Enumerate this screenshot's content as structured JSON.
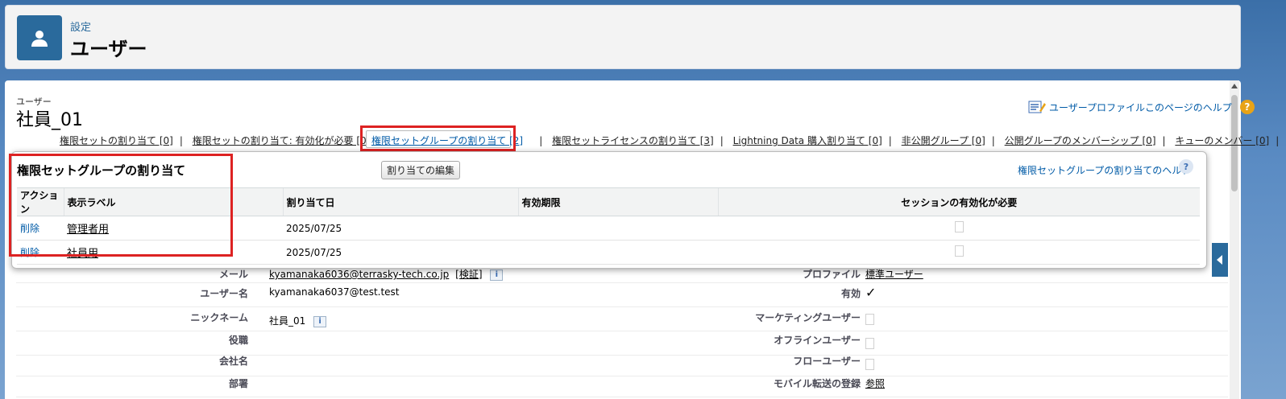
{
  "header": {
    "section": "設定",
    "title": "ユーザー"
  },
  "user": {
    "type_label": "ユーザー",
    "name": "社員_01"
  },
  "help": {
    "label": "ユーザープロファイルこのページのヘルプ",
    "q": "?"
  },
  "related_links": [
    "権限セットの割り当て [0]",
    "権限セットの割り当て: 有効化が必要 [0]",
    "権限セットグループの割り当て [2]",
    "権限セットライセンスの割り当て [3]",
    "Lightning Data 購入割り当て [0]",
    "非公開グループ [0]",
    "公開グループのメンバーシップ [0]",
    "キューのメンバー [0]"
  ],
  "overlay": {
    "title": "権限セットグループの割り当て",
    "edit_button": "割り当ての編集",
    "help_link": "権限セットグループの割り当てのヘルプ",
    "help_q": "?",
    "columns": [
      "アクション",
      "表示ラベル",
      "割り当て日",
      "有効期限",
      "セッションの有効化が必要"
    ],
    "rows": [
      {
        "action": "削除",
        "label": "管理者用",
        "date": "2025/07/25",
        "expiry": "",
        "session": false
      },
      {
        "action": "削除",
        "label": "社員用",
        "date": "2025/07/25",
        "expiry": "",
        "session": false
      }
    ]
  },
  "details": {
    "email_label": "メール",
    "email_value": "kyamanaka6036@terrasky-tech.co.jp",
    "verify": "[検証]",
    "profile_label": "プロファイル",
    "profile_value": "標準ユーザー",
    "username_label": "ユーザー名",
    "username_value": "kyamanaka6037@test.test",
    "active_label": "有効",
    "active_mark": "✓",
    "nickname_label": "ニックネーム",
    "nickname_value": "社員_01",
    "marketing_label": "マーケティングユーザー",
    "role_label": "役職",
    "offline_label": "オフラインユーザー",
    "company_label": "会社名",
    "flow_label": "フローユーザー",
    "dept_label": "部署",
    "mobile_label": "モバイル転送の登録",
    "mobile_value": "参照",
    "info_glyph": "i"
  }
}
